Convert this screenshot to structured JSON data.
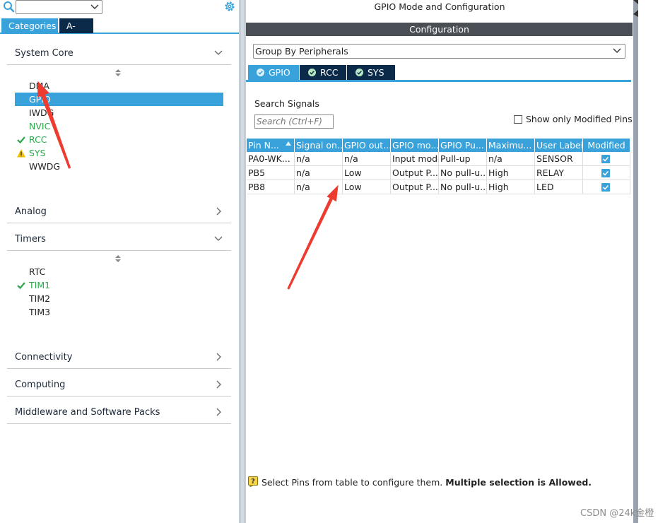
{
  "left_panel": {
    "tabs": {
      "categories": "Categories",
      "az": "A->Z"
    },
    "sections": [
      {
        "label": "System Core",
        "expanded": true
      },
      {
        "label": "Analog",
        "expanded": false
      },
      {
        "label": "Timers",
        "expanded": true
      },
      {
        "label": "Connectivity",
        "expanded": false
      },
      {
        "label": "Computing",
        "expanded": false
      },
      {
        "label": "Middleware and Software Packs",
        "expanded": false
      }
    ],
    "system_core_items": [
      {
        "label": "DMA",
        "status": "none"
      },
      {
        "label": "GPIO",
        "status": "selected"
      },
      {
        "label": "IWDG",
        "status": "none"
      },
      {
        "label": "NVIC",
        "status": "ok"
      },
      {
        "label": "RCC",
        "status": "check"
      },
      {
        "label": "SYS",
        "status": "warning"
      },
      {
        "label": "WWDG",
        "status": "none"
      }
    ],
    "timers_items": [
      {
        "label": "RTC",
        "status": "none"
      },
      {
        "label": "TIM1",
        "status": "check"
      },
      {
        "label": "TIM2",
        "status": "none"
      },
      {
        "label": "TIM3",
        "status": "none"
      }
    ]
  },
  "right_panel": {
    "title": "GPIO Mode and Configuration",
    "config_title": "Configuration",
    "group_select": "Group By Peripherals",
    "tabs": [
      "GPIO",
      "RCC",
      "SYS"
    ],
    "search_label": "Search Signals",
    "search_placeholder": "Search (Ctrl+F)",
    "show_modified_label": "Show only Modified Pins",
    "table": {
      "headers": [
        "Pin N...",
        "Signal on...",
        "GPIO out...",
        "GPIO mo...",
        "GPIO Pu...",
        "Maximu...",
        "User Label",
        "Modified"
      ],
      "rows": [
        [
          "PA0-WK...",
          "n/a",
          "n/a",
          "Input mode",
          "Pull-up",
          "n/a",
          "SENSOR",
          true
        ],
        [
          "PB5",
          "n/a",
          "Low",
          "Output P...",
          "No pull-u...",
          "High",
          "RELAY",
          true
        ],
        [
          "PB8",
          "n/a",
          "Low",
          "Output P...",
          "No pull-u...",
          "High",
          "LED",
          true
        ]
      ]
    },
    "hint_text": "Select Pins from table to configure them.",
    "hint_bold": "Multiple selection is Allowed."
  },
  "watermark": "CSDN @24k金橙",
  "colors": {
    "accent": "#39a2db",
    "navy": "#0b2a4a",
    "ok": "#2aa84a",
    "warning": "#f2c200",
    "annotation": "#ee3b2f"
  }
}
